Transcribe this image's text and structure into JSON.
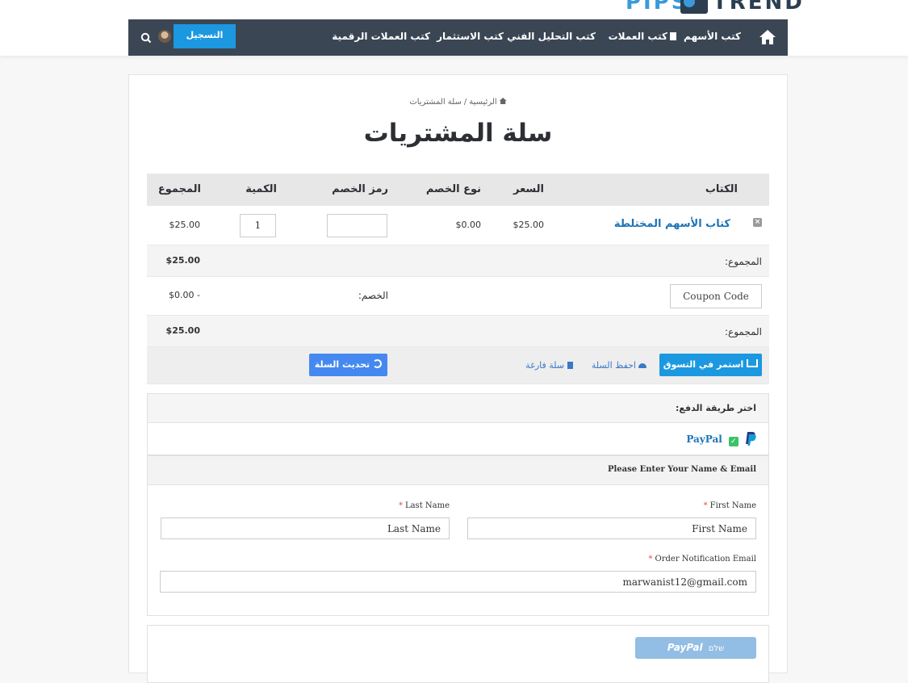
{
  "brand": {
    "part1": "PIPS",
    "part2": "TREND"
  },
  "nav": {
    "items": [
      "كتب الأسهم",
      "كتب العملات",
      "كتب التحليل الفني",
      "كتب الاستثمار",
      "كتب العملات الرقمية"
    ],
    "register_label": "التسجيل",
    "accent": "#1b98e0",
    "bar_color": "#3b4654"
  },
  "breadcrumb": {
    "home": "الرئيسية",
    "separator": "/",
    "current": "سلة المشتريات"
  },
  "page_title": "سلة المشتريات",
  "cart": {
    "headers": {
      "book": "الكتاب",
      "price": "السعر",
      "discount_type": "نوع الخصم",
      "discount_code": "رمز الخصم",
      "quantity": "الكمية",
      "total": "المجموع"
    },
    "item": {
      "name": "كتاب الأسهم المختلطة",
      "price": "$25.00",
      "discount_type": "$0.00",
      "quantity": "1",
      "total": "$25.00"
    },
    "subtotal_label": "المجموع:",
    "subtotal_value": "$25.00",
    "coupon_placeholder": "Coupon Code",
    "discount_label": "الخصم:",
    "discount_value": "$0.00 -",
    "total_label": "المجموع:",
    "total_value": "$25.00",
    "continue_label": "استمر في التسوق",
    "save_label": "احفظ السلة",
    "empty_label": "سلة فارغة",
    "update_label": "تحديث السلة"
  },
  "payment": {
    "title": "اختر طريقة الدفع:",
    "method": "PayPal",
    "paypal_color": "#1b74b8"
  },
  "form": {
    "title": "Please Enter Your Name & Email",
    "first_name_label": "First Name",
    "first_name_placeholder": "First Name",
    "last_name_label": "Last Name",
    "last_name_placeholder": "Last Name",
    "email_label": "Order Notification Email",
    "email_value": "marwanist12@gmail.com",
    "required_mark": "*"
  },
  "checkout": {
    "paypal_button_brand": "PayPal",
    "paypal_button_text": "שלם"
  }
}
